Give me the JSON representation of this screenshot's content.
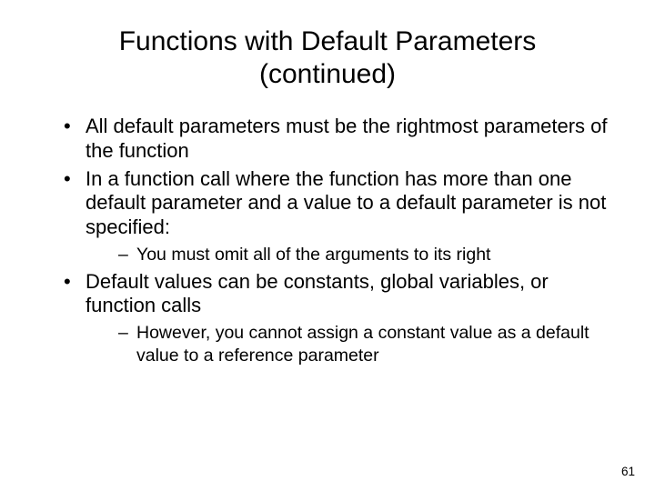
{
  "title": "Functions with Default Parameters (continued)",
  "bullets": {
    "b1": "All default parameters must be the rightmost parameters of the function",
    "b2": "In a function call where the function has more than one default parameter and a value to a default parameter is not specified:",
    "b2a": "You must omit all of the arguments to its right",
    "b3": "Default values can be constants, global variables, or function calls",
    "b3a": "However, you cannot assign a constant value as a default value to a reference parameter"
  },
  "page_number": "61"
}
